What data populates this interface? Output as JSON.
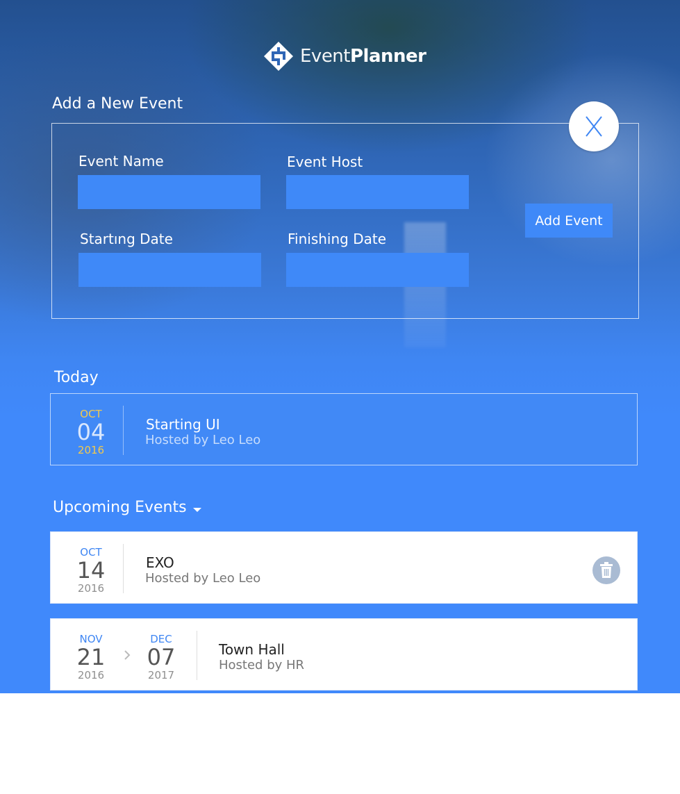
{
  "header": {
    "logo_text_light": "Event",
    "logo_text_bold": "Planner"
  },
  "form": {
    "title": "Add a New Event",
    "fields": {
      "event_name": {
        "label": "Event Name",
        "value": "",
        "placeholder": ""
      },
      "event_host": {
        "label": "Event Host",
        "value": "",
        "placeholder": ""
      },
      "starting_date": {
        "label": "Startıng Date",
        "value": "",
        "placeholder": ""
      },
      "finishing_date": {
        "label": "Finishing Date",
        "value": "",
        "placeholder": ""
      }
    },
    "submit_label": "Add Event",
    "close_icon": "close-x-icon"
  },
  "today": {
    "title": "Today",
    "event": {
      "month": "OCT",
      "day": "04",
      "year": "2016",
      "name": "Starting UI",
      "host": "Hosted by Leo Leo"
    }
  },
  "upcoming": {
    "title": "Upcoming Events",
    "toggle_icon": "caret-down-icon",
    "events": [
      {
        "start": {
          "month": "OCT",
          "day": "14",
          "year": "2016"
        },
        "name": "EXO",
        "host": "Hosted by Leo Leo",
        "action_icon": "trash-icon"
      },
      {
        "start": {
          "month": "NOV",
          "day": "21",
          "year": "2016"
        },
        "end": {
          "month": "DEC",
          "day": "07",
          "year": "2017"
        },
        "range_icon": "chevron-right-icon",
        "name": "Town Hall",
        "host": "Hosted by HR"
      }
    ]
  },
  "colors": {
    "primary": "#4089fb",
    "input_bg": "#3f89f8",
    "today_year": "#f2c94c",
    "month_blue": "#3f86f3",
    "muted_gray": "#8f8f8f",
    "dark_text": "#333333",
    "trash_bg": "#a9bbd3"
  }
}
